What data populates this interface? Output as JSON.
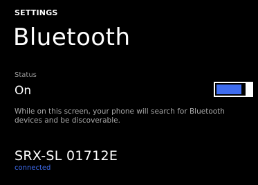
{
  "header": {
    "app_title": "SETTINGS",
    "page_title": "Bluetooth"
  },
  "status": {
    "label": "Status",
    "value": "On",
    "toggle_on": true
  },
  "description": "While on this screen, your phone will search for Bluetooth devices and be discoverable.",
  "devices": [
    {
      "name": "SRX-SL 01712E",
      "status": "connected"
    }
  ],
  "colors": {
    "background": "#000000",
    "foreground": "#ffffff",
    "secondary_text": "#9a9a9a",
    "accent": "#3f6df0"
  }
}
